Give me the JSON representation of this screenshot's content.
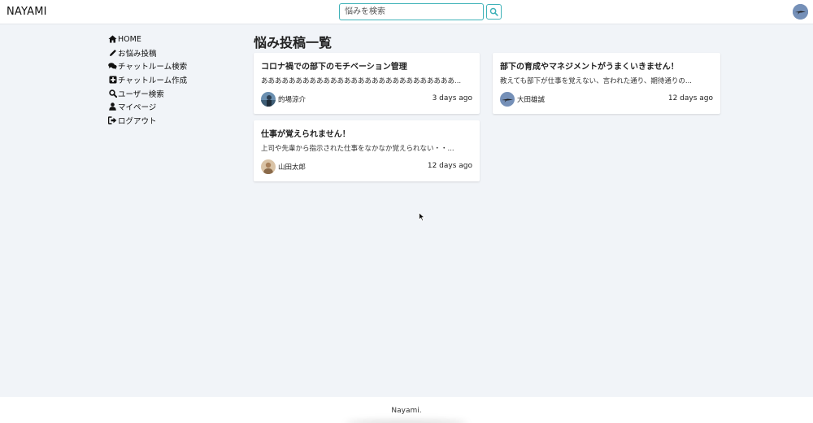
{
  "header": {
    "brand": "NAYAMI",
    "search": {
      "placeholder": "悩みを検索",
      "value": ""
    }
  },
  "sidebar": {
    "items": [
      {
        "label": "HOME",
        "icon": "home-icon"
      },
      {
        "label": "お悩み投稿",
        "icon": "pencil-icon"
      },
      {
        "label": "チャットルーム検索",
        "icon": "comments-icon"
      },
      {
        "label": "チャットルーム作成",
        "icon": "plus-square-icon"
      },
      {
        "label": "ユーザー検索",
        "icon": "search-icon"
      },
      {
        "label": "マイページ",
        "icon": "user-icon"
      },
      {
        "label": "ログアウト",
        "icon": "sign-out-icon"
      }
    ]
  },
  "main": {
    "title": "悩み投稿一覧",
    "posts": [
      {
        "title": "コロナ禍での部下のモチベーション管理",
        "excerpt": "ああああああああああああああああああああああああああああ...",
        "author": "的場涼介",
        "time": "3 days ago"
      },
      {
        "title": "部下の育成やマネジメントがうまくいきません！",
        "excerpt": "教えても部下が仕事を覚えない、言われた通り、期待通りの...",
        "author": "大田雄誠",
        "time": "12 days ago"
      },
      {
        "title": "仕事が覚えられません！",
        "excerpt": "上司や先輩から指示された仕事をなかなか覚えられない・・...",
        "author": "山田太郎",
        "time": "12 days ago"
      }
    ]
  },
  "footer": {
    "text": "Nayami."
  },
  "colors": {
    "accent": "#3fb2b8",
    "background": "#f1f4f8",
    "card": "#ffffff"
  }
}
